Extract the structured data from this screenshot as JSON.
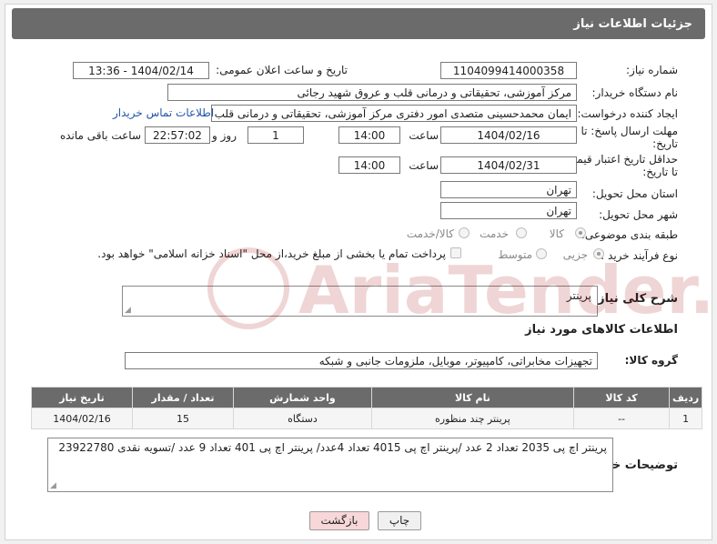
{
  "header": {
    "title": "جزئیات اطلاعات نیاز"
  },
  "form": {
    "need_number_label": "شماره نیاز:",
    "need_number": "1104099414000358",
    "announce_label": "تاریخ و ساعت اعلان عمومی:",
    "announce_value": "1404/02/14 - 13:36",
    "buyer_org_label": "نام دستگاه خریدار:",
    "buyer_org": "مرکز آموزشی، تحقیقاتی و درمانی قلب و عروق شهید رجائی",
    "requester_label": "ایجاد کننده درخواست:",
    "requester": "ایمان محمدحسینی متصدی امور دفتری مرکز آموزشی، تحقیقاتی و درمانی قلب",
    "buyer_contact_link": "اطلاعات تماس خریدار",
    "deadline_label_1": "مهلت ارسال پاسخ: تا",
    "deadline_label_2": "تاریخ:",
    "deadline_date": "1404/02/16",
    "hour_label": "ساعت",
    "deadline_time": "14:00",
    "days_value": "1",
    "days_label": "روز و",
    "remaining_time": "22:57:02",
    "remaining_label": "ساعت باقی مانده",
    "validity_label_1": "حداقل تاریخ اعتبار قیمت:",
    "validity_label_2": "تا تاریخ:",
    "validity_date": "1404/02/31",
    "validity_time": "14:00",
    "province_label": "استان محل تحویل:",
    "province": "تهران",
    "city_label": "شهر محل تحویل:",
    "city": "تهران",
    "category_label": "طبقه بندی موضوعی:",
    "category_options": [
      "کالا",
      "خدمت",
      "کالا/خدمت"
    ],
    "category_selected": "کالا",
    "purchase_type_label": "نوع فرآیند خرید :",
    "purchase_options": [
      "جزیی",
      "متوسط"
    ],
    "purchase_selected": "جزیی",
    "payment_note": "پرداخت تمام یا بخشی از مبلغ خرید،از محل \"اسناد خزانه اسلامی\" خواهد بود."
  },
  "general_desc": {
    "label": "شرح کلی نیاز:",
    "value": "پرینتر"
  },
  "goods_section": {
    "title": "اطلاعات کالاهای مورد نیاز"
  },
  "goods_group": {
    "label": "گروه کالا:",
    "value": "تجهیزات مخابراتی، کامپیوتر، موبایل، ملزومات جانبی و شبکه"
  },
  "goods_table": {
    "headers": [
      "ردیف",
      "کد کالا",
      "نام کالا",
      "واحد شمارش",
      "تعداد / مقدار",
      "تاریخ نیاز"
    ],
    "rows": [
      [
        "1",
        "--",
        "پرینتر چند منظوره",
        "دستگاه",
        "15",
        "1404/02/16"
      ]
    ]
  },
  "buyer_notes": {
    "label": "توضیحات خریدار:",
    "value": "پرینتر اچ پی 2035 تعداد 2 عدد /پرینتر اچ پی 4015 تعداد 4عدد/ پرینتر اچ پی 401 تعداد 9 عدد /تسویه نقدی 23922780"
  },
  "buttons": {
    "print": "چاپ",
    "back": "بازگشت"
  },
  "colors": {
    "header_bg": "#6b6b6b",
    "link": "#2255aa",
    "back_button_bg": "#f7d7d7"
  }
}
